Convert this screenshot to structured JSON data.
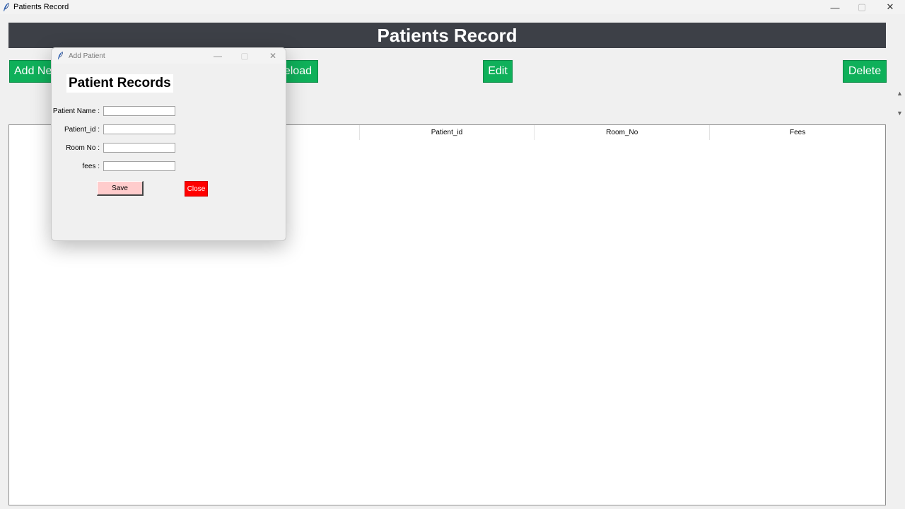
{
  "window": {
    "title": "Patients Record",
    "controls": {
      "minimize": "—",
      "maximize": "▢",
      "close": "✕"
    }
  },
  "header": {
    "title": "Patients Record"
  },
  "toolbar": {
    "add_new_label": "Add New",
    "reload_label": "Reload",
    "edit_label": "Edit",
    "delete_label": "Delete",
    "accent_color": "#0fb05a"
  },
  "table": {
    "columns": [
      "",
      "",
      "Patient_id",
      "Room_No",
      "Fees"
    ],
    "rows": []
  },
  "dialog": {
    "title": "Add Patient",
    "controls": {
      "minimize": "—",
      "maximize": "▢",
      "close": "✕"
    },
    "heading": "Patient Records",
    "fields": [
      {
        "label": "Patient Name :",
        "value": ""
      },
      {
        "label": "Patient_id :",
        "value": ""
      },
      {
        "label": "Room No :",
        "value": ""
      },
      {
        "label": "fees :",
        "value": ""
      }
    ],
    "save_label": "Save",
    "close_label": "Close"
  },
  "scroll": {
    "up": "▲",
    "down": "▼"
  },
  "icons": {
    "app": "feather-icon"
  }
}
